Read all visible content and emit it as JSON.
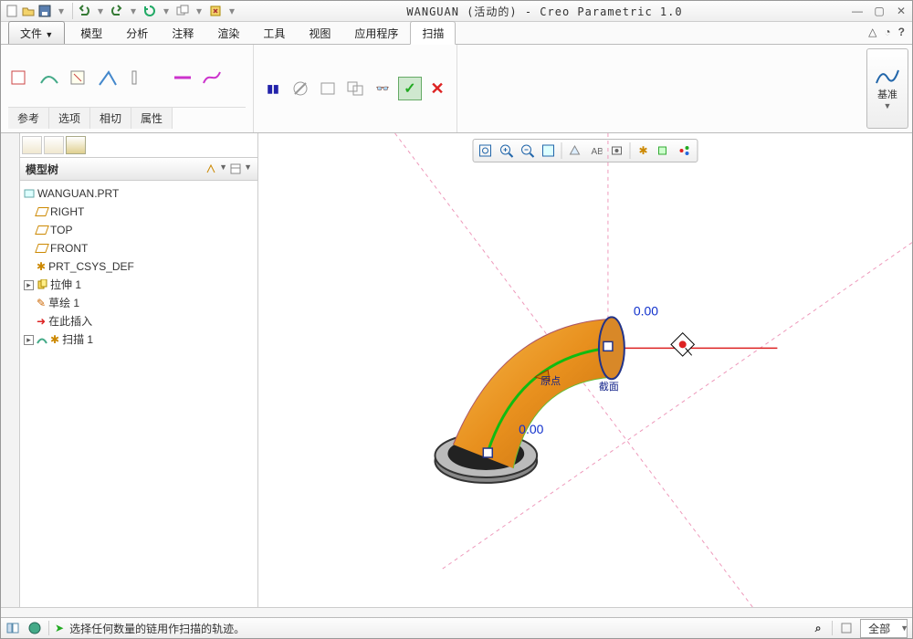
{
  "title": "WANGUAN (活动的) - Creo Parametric 1.0",
  "ribbon_tabs": {
    "file": "文件",
    "items": [
      "模型",
      "分析",
      "注释",
      "渲染",
      "工具",
      "视图",
      "应用程序",
      "扫描"
    ],
    "active": "扫描"
  },
  "sub_tabs": [
    "参考",
    "选项",
    "相切",
    "属性"
  ],
  "basis_label": "基准",
  "tree": {
    "header": "模型树",
    "root": "WANGUAN.PRT",
    "nodes": {
      "right": "RIGHT",
      "top": "TOP",
      "front": "FRONT",
      "csys": "PRT_CSYS_DEF",
      "extrude": "拉伸 1",
      "sketch": "草绘 1",
      "insert": "在此插入",
      "sweep": "扫描 1"
    }
  },
  "viewport": {
    "dim1": "0.00",
    "dim2": "0.00",
    "label_origin": "原点",
    "label_section": "截面"
  },
  "status": {
    "msg": "选择任何数量的链用作扫描的轨迹。",
    "filter": "全部"
  },
  "icons": {
    "new": "new",
    "open": "open",
    "save": "save",
    "undo": "undo",
    "redo": "redo",
    "regen": "regen",
    "windows": "win",
    "close": "close"
  }
}
